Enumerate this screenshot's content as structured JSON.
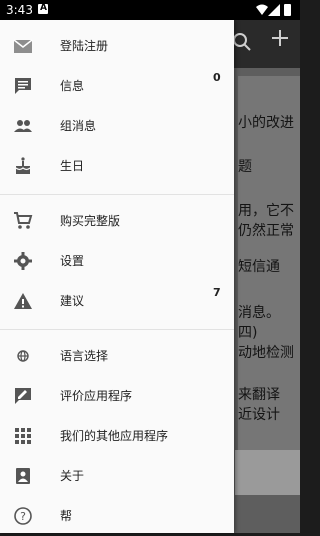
{
  "status_bar": {
    "time": "3:43"
  },
  "app": {
    "content_lines": [
      "小的改进",
      "题",
      "用，它不",
      "仍然正常",
      "短信通",
      "消息。",
      "四)",
      "动地检测",
      "来翻译",
      "近设计"
    ]
  },
  "drawer": {
    "group1": [
      {
        "label": "登陆注册",
        "icon": "email-icon"
      },
      {
        "label": "信息",
        "icon": "message-icon",
        "count": "0"
      },
      {
        "label": "组消息",
        "icon": "group-icon"
      },
      {
        "label": "生日",
        "icon": "cake-icon"
      }
    ],
    "group2": [
      {
        "label": "购买完整版",
        "icon": "cart-icon"
      },
      {
        "label": "设置",
        "icon": "gear-icon"
      },
      {
        "label": "建议",
        "icon": "warning-icon",
        "count": "7"
      }
    ],
    "group3": [
      {
        "label": "语言选择",
        "icon": "globe-icon"
      },
      {
        "label": "评价应用程序",
        "icon": "rate-icon"
      },
      {
        "label": "我们的其他应用程序",
        "icon": "apps-grid-icon"
      },
      {
        "label": "关于",
        "icon": "about-icon"
      },
      {
        "label": "帮",
        "icon": "help-icon"
      }
    ]
  }
}
